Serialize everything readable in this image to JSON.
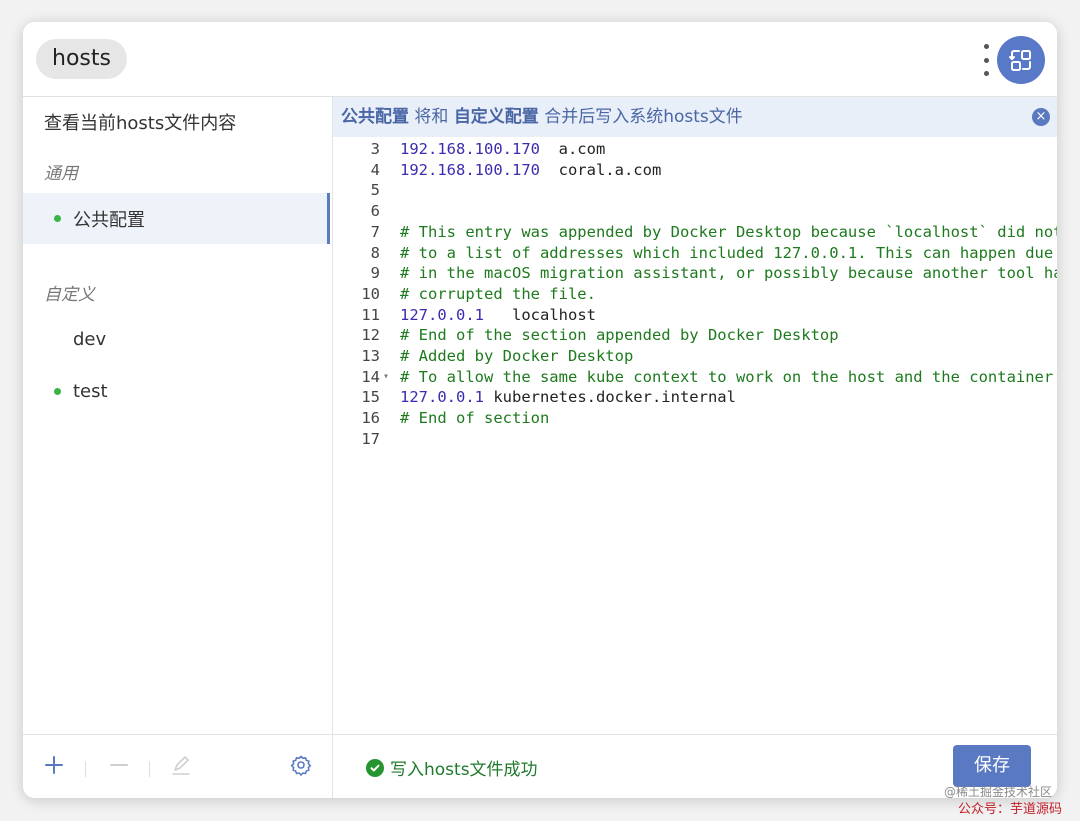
{
  "app": {
    "title": "hosts"
  },
  "colors": {
    "accent": "#5a79c3",
    "active_dot": "#3cb346",
    "success": "#25962f",
    "comment": "#1e7a1e",
    "ip": "#3a2cb0"
  },
  "sidebar": {
    "view_current": "查看当前hosts文件内容",
    "section_common": "通用",
    "common_item": {
      "label": "公共配置",
      "active": true,
      "enabled": true
    },
    "section_custom": "自定义",
    "custom_items": [
      {
        "label": "dev",
        "enabled": false
      },
      {
        "label": "test",
        "enabled": true
      }
    ],
    "footer_icons": [
      "plus-icon",
      "minus-icon",
      "edit-icon",
      "gear-icon"
    ]
  },
  "banner": {
    "part1": "公共配置",
    "part2": " 将和 ",
    "part3": "自定义配置",
    "part4": " 合并后写入系统hosts文件",
    "close_icon": "close-icon"
  },
  "editor": {
    "lines": [
      {
        "n": "3",
        "ip": "192.168.100.170",
        "host": "  a.com"
      },
      {
        "n": "4",
        "ip": "192.168.100.170",
        "host": "  coral.a.com"
      },
      {
        "n": "5"
      },
      {
        "n": "6"
      },
      {
        "n": "7",
        "comment": "# This entry was appended by Docker Desktop because `localhost` did not"
      },
      {
        "n": "8",
        "comment": "# to a list of addresses which included 127.0.0.1. This can happen due"
      },
      {
        "n": "9",
        "comment": "# in the macOS migration assistant, or possibly because another tool ha"
      },
      {
        "n": "10",
        "comment": "# corrupted the file."
      },
      {
        "n": "11",
        "ip": "127.0.0.1",
        "host": "   localhost"
      },
      {
        "n": "12",
        "comment": "# End of the section appended by Docker Desktop"
      },
      {
        "n": "13",
        "comment": "# Added by Docker Desktop"
      },
      {
        "n": "14",
        "fold": true,
        "comment": "# To allow the same kube context to work on the host and the container:"
      },
      {
        "n": "15",
        "ip": "127.0.0.1",
        "host": " kubernetes.docker.internal"
      },
      {
        "n": "16",
        "comment": "# End of section"
      },
      {
        "n": "17"
      }
    ]
  },
  "footer": {
    "status": "写入hosts文件成功",
    "save_label": "保存"
  },
  "watermark": {
    "line1": "@稀土掘金技术社区",
    "line2": "公众号：芋道源码"
  }
}
